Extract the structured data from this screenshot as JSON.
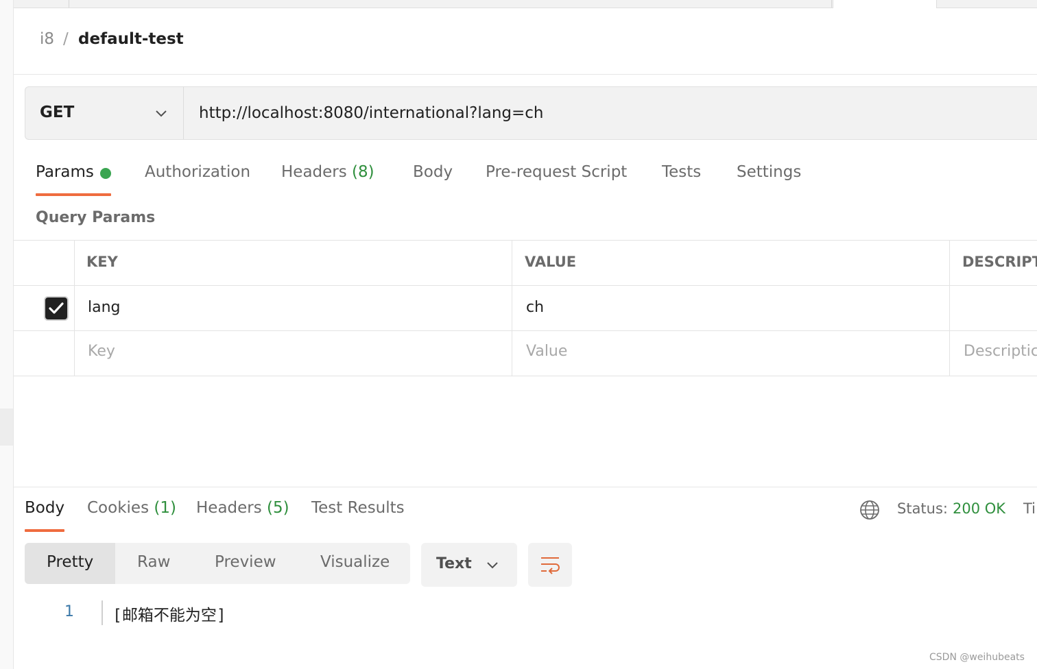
{
  "breadcrumb": {
    "workspace": "i8",
    "separator": "/",
    "request_name": "default-test"
  },
  "request": {
    "method": "GET",
    "url": "http://localhost:8080/international?lang=ch"
  },
  "request_tabs": [
    {
      "label": "Params",
      "active": true,
      "has_indicator": true
    },
    {
      "label": "Authorization"
    },
    {
      "label": "Headers",
      "count": "(8)"
    },
    {
      "label": "Body"
    },
    {
      "label": "Pre-request Script"
    },
    {
      "label": "Tests"
    },
    {
      "label": "Settings"
    }
  ],
  "query_params": {
    "title": "Query Params",
    "columns": [
      "KEY",
      "VALUE",
      "DESCRIPT"
    ],
    "rows": [
      {
        "checked": true,
        "key": "lang",
        "value": "ch"
      }
    ],
    "placeholders": {
      "key": "Key",
      "value": "Value",
      "description": "Descriptic"
    }
  },
  "response": {
    "tabs": [
      {
        "label": "Body",
        "active": true
      },
      {
        "label": "Cookies",
        "count": "(1)"
      },
      {
        "label": "Headers",
        "count": "(5)"
      },
      {
        "label": "Test Results"
      }
    ],
    "status_label": "Status:",
    "status_value": "200 OK",
    "time_label": "Ti",
    "view_modes": [
      "Pretty",
      "Raw",
      "Preview",
      "Visualize"
    ],
    "active_view": "Pretty",
    "format": "Text",
    "body_lines": [
      {
        "number": "1",
        "text": "[邮箱不能为空]"
      }
    ]
  },
  "watermark": "CSDN @weihubeats",
  "colors": {
    "accent": "#ef6c3f",
    "success": "#2f8f3d",
    "indicator": "#3aa551"
  },
  "icons": [
    "chevron-down-icon",
    "checkbox-checked-icon",
    "globe-icon",
    "wrap-lines-icon"
  ]
}
